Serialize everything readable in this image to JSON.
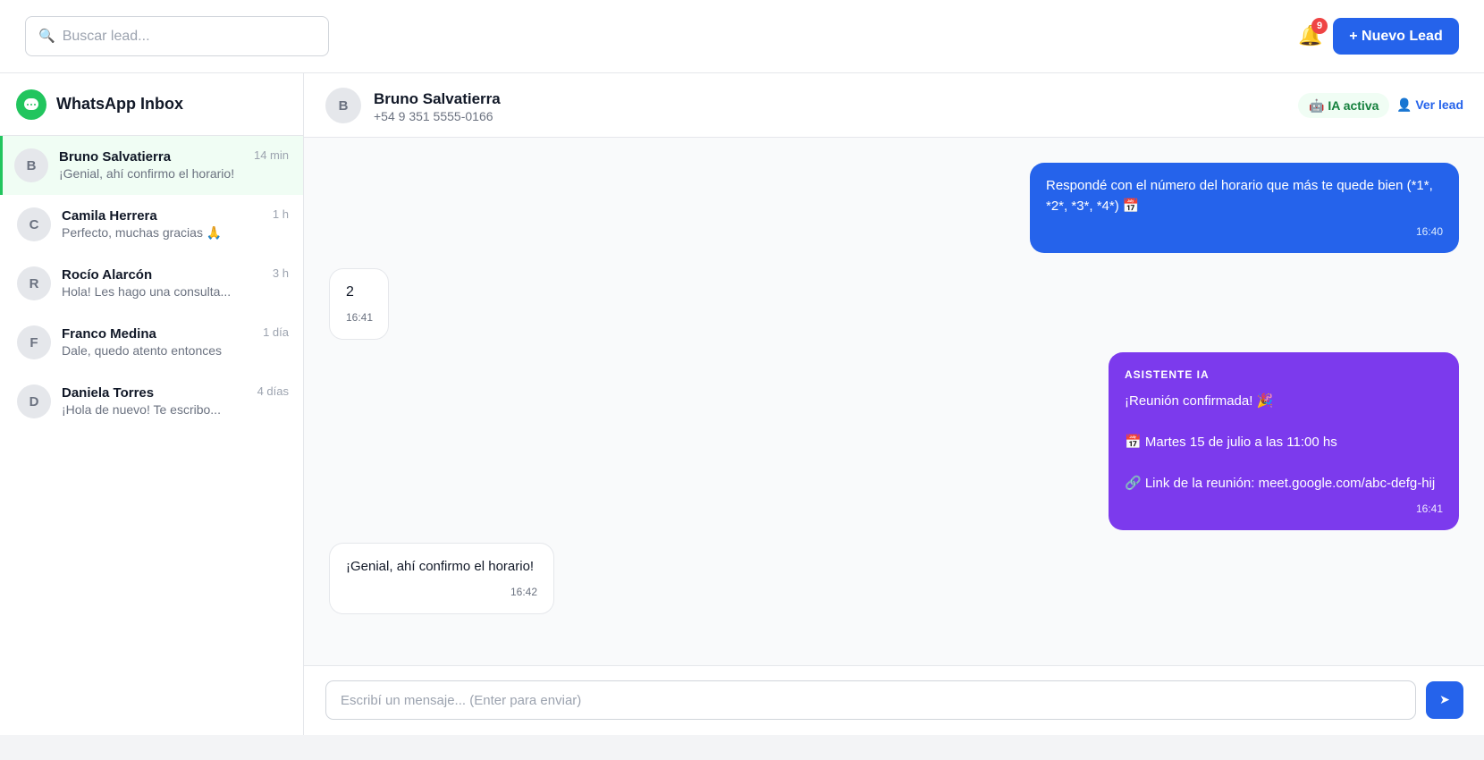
{
  "topbar": {
    "search_placeholder": "Buscar lead...",
    "search_icon": "🔍",
    "bell_icon": "🔔",
    "notifications_count": "9",
    "new_lead_label": "+ Nuevo Lead"
  },
  "sidebar": {
    "title": "WhatsApp Inbox",
    "logo": "whatsapp-chat-icon",
    "conversations": [
      {
        "initial": "B",
        "name": "Bruno Salvatierra",
        "preview": "¡Genial, ahí confirmo el horario!",
        "time": "14 min",
        "active": true
      },
      {
        "initial": "C",
        "name": "Camila Herrera",
        "preview": "Perfecto, muchas gracias 🙏",
        "time": "1 h",
        "active": false
      },
      {
        "initial": "R",
        "name": "Rocío Alarcón",
        "preview": "Hola! Les hago una consulta...",
        "time": "3 h",
        "active": false
      },
      {
        "initial": "F",
        "name": "Franco Medina",
        "preview": "Dale, quedo atento entonces",
        "time": "1 día",
        "active": false
      },
      {
        "initial": "D",
        "name": "Daniela Torres",
        "preview": "¡Hola de nuevo! Te escribo...",
        "time": "4 días",
        "active": false
      }
    ]
  },
  "chat": {
    "contact": {
      "initial": "B",
      "name": "Bruno Salvatierra",
      "phone": "+54 9 351 5555-0166"
    },
    "ia_status": "🤖 IA activa",
    "ver_lead_label": "👤 Ver lead",
    "messages": [
      {
        "type": "out",
        "line1": "Respondé con el número del horario que más te quede bien (*1*,",
        "line2": "*2*, *3*, *4*) 📅",
        "time": "16:40"
      },
      {
        "type": "in",
        "text": "2",
        "time": "16:41"
      },
      {
        "type": "ai",
        "label": "ASISTENTE IA",
        "line1": "¡Reunión confirmada! 🎉",
        "line2": "📅 Martes 15 de julio a las 11:00 hs",
        "line3": "🔗 Link de la reunión: meet.google.com/abc-defg-hij",
        "time": "16:41"
      },
      {
        "type": "in",
        "text": "¡Genial, ahí confirmo el horario!",
        "time": "16:42"
      }
    ],
    "composer_placeholder": "Escribí un mensaje... (Enter para enviar)",
    "send_icon": "➤"
  },
  "colors": {
    "brand_blue": "#2563eb",
    "whatsapp_green": "#22c55e",
    "ai_purple": "#7c3aed",
    "badge_red": "#ef4444"
  }
}
